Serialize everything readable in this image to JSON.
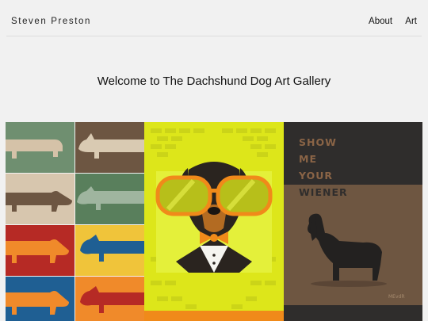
{
  "header": {
    "brand": "Steven Preston",
    "nav": [
      {
        "label": "About"
      },
      {
        "label": "Art"
      }
    ]
  },
  "main": {
    "welcome": "Welcome to The Dachshund Dog Art Gallery"
  },
  "gallery": {
    "artworks": [
      {
        "name": "pop-art-dachshund-grid",
        "tiles": [
          {
            "bg": "#6f8f70",
            "dog": "#d5c2a8"
          },
          {
            "bg": "#6d5642",
            "dog": "#d9cab2"
          },
          {
            "bg": "#d7c6ae",
            "dog": "#6d5642"
          },
          {
            "bg": "#597f5c",
            "dog": "#9fb59f"
          },
          {
            "bg": "#b62a25",
            "dog": "#f08a2a"
          },
          {
            "bg": "#f0c43a",
            "dog": "#1f5f93"
          },
          {
            "bg": "#1f5f93",
            "dog": "#f08a2a"
          },
          {
            "bg": "#f08a2a",
            "dog": "#b62a25"
          }
        ]
      },
      {
        "name": "dachshund-sunglasses-bowtie",
        "colors": {
          "bg": "#dde61a",
          "accent": "#f08a1a",
          "dog": "#2a241f"
        }
      },
      {
        "name": "show-me-your-wiener",
        "lines": [
          "SHOW",
          "ME",
          "YOUR",
          "WIENER"
        ],
        "signature": "MEvdR",
        "colors": {
          "bg": "#2f2d2c",
          "text": "#8a6446",
          "brown": "#6e5641"
        }
      }
    ]
  }
}
